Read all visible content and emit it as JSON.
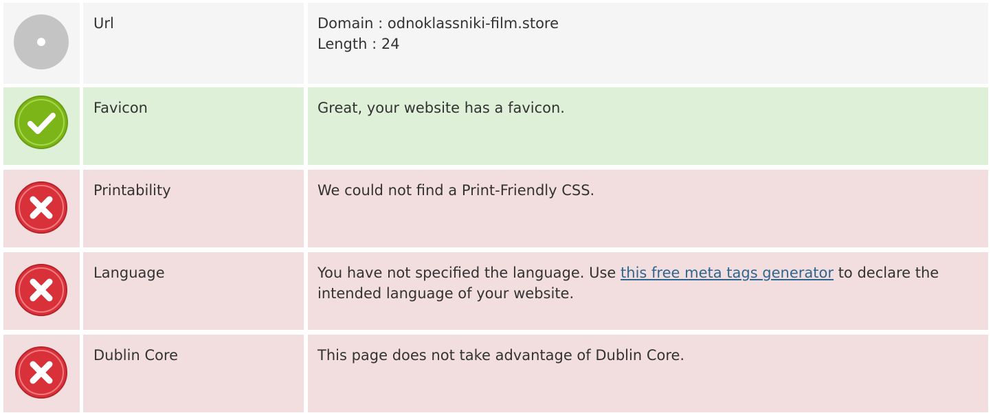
{
  "rows": [
    {
      "status": "neutral",
      "icon": "info-circle-icon",
      "label": "Url",
      "line1": "Domain : odnoklassniki-film.store",
      "line2": "Length : 24"
    },
    {
      "status": "success",
      "icon": "checkmark-icon",
      "label": "Favicon",
      "text": "Great, your website has a favicon."
    },
    {
      "status": "error",
      "icon": "error-cross-icon",
      "label": "Printability",
      "text": "We could not find a Print-Friendly CSS."
    },
    {
      "status": "error",
      "icon": "error-cross-icon",
      "label": "Language",
      "text_before": "You have not specified the language. Use ",
      "link_text": "this free meta tags generator",
      "text_after": " to declare the intended language of your website."
    },
    {
      "status": "error",
      "icon": "error-cross-icon",
      "label": "Dublin Core",
      "text": "This page does not take advantage of Dublin Core."
    }
  ],
  "colors": {
    "neutral_bg": "#f5f5f5",
    "success_bg": "#dff0d8",
    "error_bg": "#f2dede",
    "link": "#2f6690",
    "success_icon": "#7cb518",
    "error_icon": "#d9313a",
    "neutral_icon": "#c4c4c4"
  }
}
